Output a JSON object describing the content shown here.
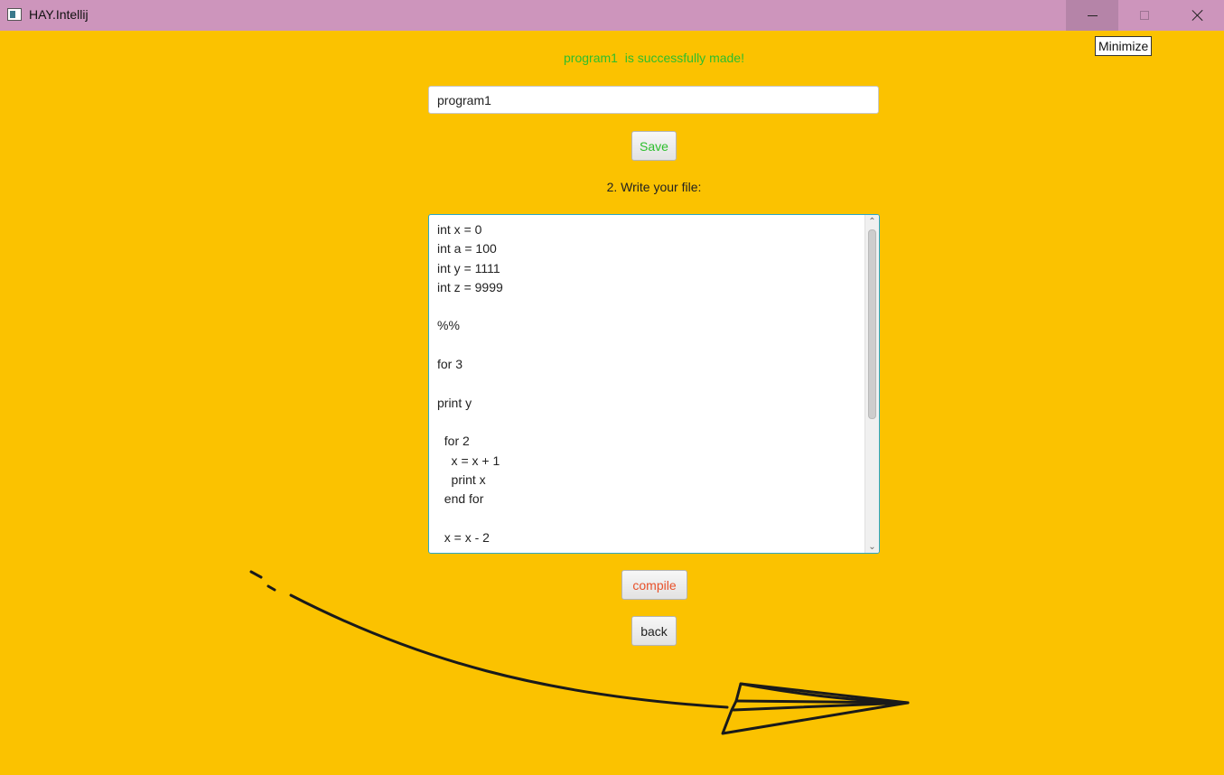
{
  "window": {
    "title": "HAY.Intellij",
    "tooltip": "Minimize"
  },
  "status": {
    "message": "program1  is successfully made!",
    "color": "#2DBE2D"
  },
  "name_field": {
    "value": "program1"
  },
  "buttons": {
    "save_label": "Save",
    "compile_label": "compile",
    "back_label": "back"
  },
  "editor": {
    "label": "2. Write your file:",
    "content": "int x = 0\nint a = 100\nint y = 1111\nint z = 9999\n\n%%\n\nfor 3\n\nprint y\n\n  for 2\n    x = x + 1\n    print x\n  end for\n\n  x = x - 2"
  },
  "colors": {
    "background": "#FBC200",
    "titlebar": "#CD95BC",
    "save_text": "#2DBE2D",
    "compile_text": "#E8512A",
    "editor_focus_border": "#2AA7C9"
  },
  "icons": [
    "app-icon",
    "minimize-icon",
    "maximize-icon",
    "close-icon",
    "paper-plane-icon"
  ]
}
